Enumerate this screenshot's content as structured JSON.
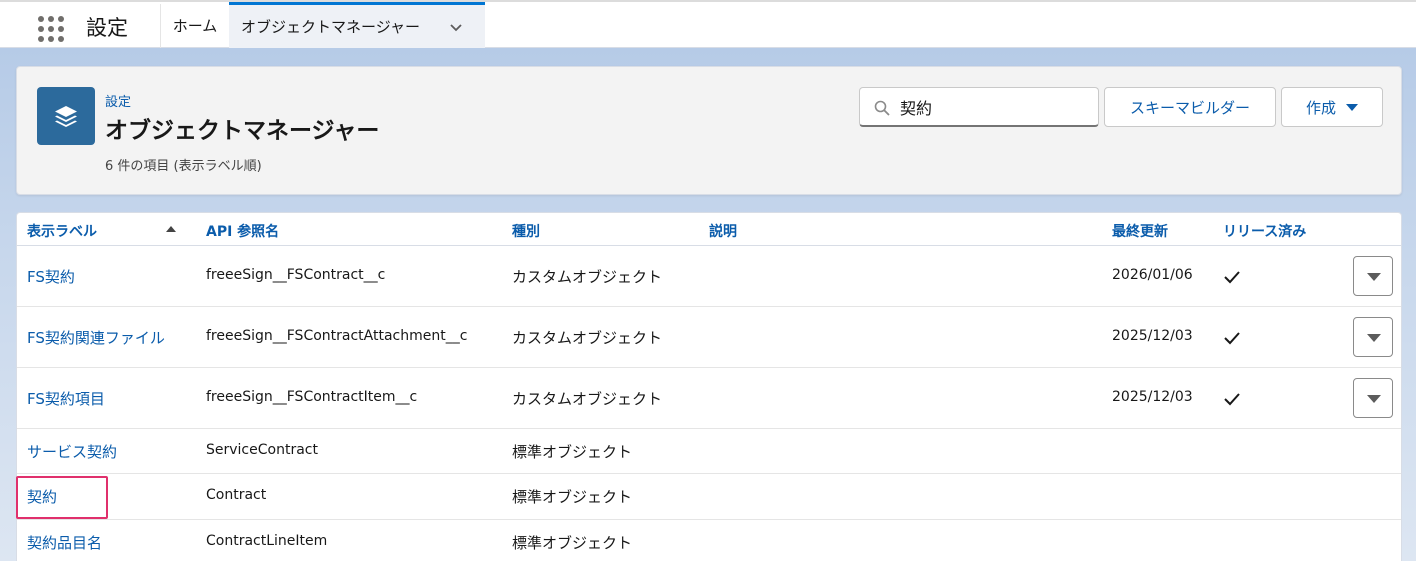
{
  "nav": {
    "app_name": "設定",
    "tabs": [
      {
        "label": "ホーム"
      },
      {
        "label": "オブジェクトマネージャー"
      }
    ]
  },
  "header": {
    "breadcrumb": "設定",
    "title": "オブジェクトマネージャー",
    "item_count": "6 件の項目 (表示ラベル順)",
    "search_value": "契約",
    "schema_builder_label": "スキーマビルダー",
    "create_label": "作成"
  },
  "table": {
    "columns": [
      "表示ラベル",
      "API 参照名",
      "種別",
      "説明",
      "最終更新",
      "リリース済み"
    ],
    "rows": [
      {
        "label": "FS契約",
        "api": "freeeSign__FSContract__c",
        "kind": "カスタムオブジェクト",
        "description": "",
        "updated": "2026/01/06",
        "deployed": true
      },
      {
        "label": "FS契約関連ファイル",
        "api": "freeeSign__FSContractAttachment__c",
        "kind": "カスタムオブジェクト",
        "description": "",
        "updated": "2025/12/03",
        "deployed": true
      },
      {
        "label": "FS契約項目",
        "api": "freeeSign__FSContractItem__c",
        "kind": "カスタムオブジェクト",
        "description": "",
        "updated": "2025/12/03",
        "deployed": true
      },
      {
        "label": "サービス契約",
        "api": "ServiceContract",
        "kind": "標準オブジェクト",
        "description": "",
        "updated": "",
        "deployed": false
      },
      {
        "label": "契約",
        "api": "Contract",
        "kind": "標準オブジェクト",
        "description": "",
        "updated": "",
        "deployed": false
      },
      {
        "label": "契約品目名",
        "api": "ContractLineItem",
        "kind": "標準オブジェクト",
        "description": "",
        "updated": "",
        "deployed": false
      }
    ]
  },
  "colors": {
    "brand_blue": "#0b5cab",
    "icon_bg": "#2c6a9c",
    "highlight": "#e0306c"
  }
}
